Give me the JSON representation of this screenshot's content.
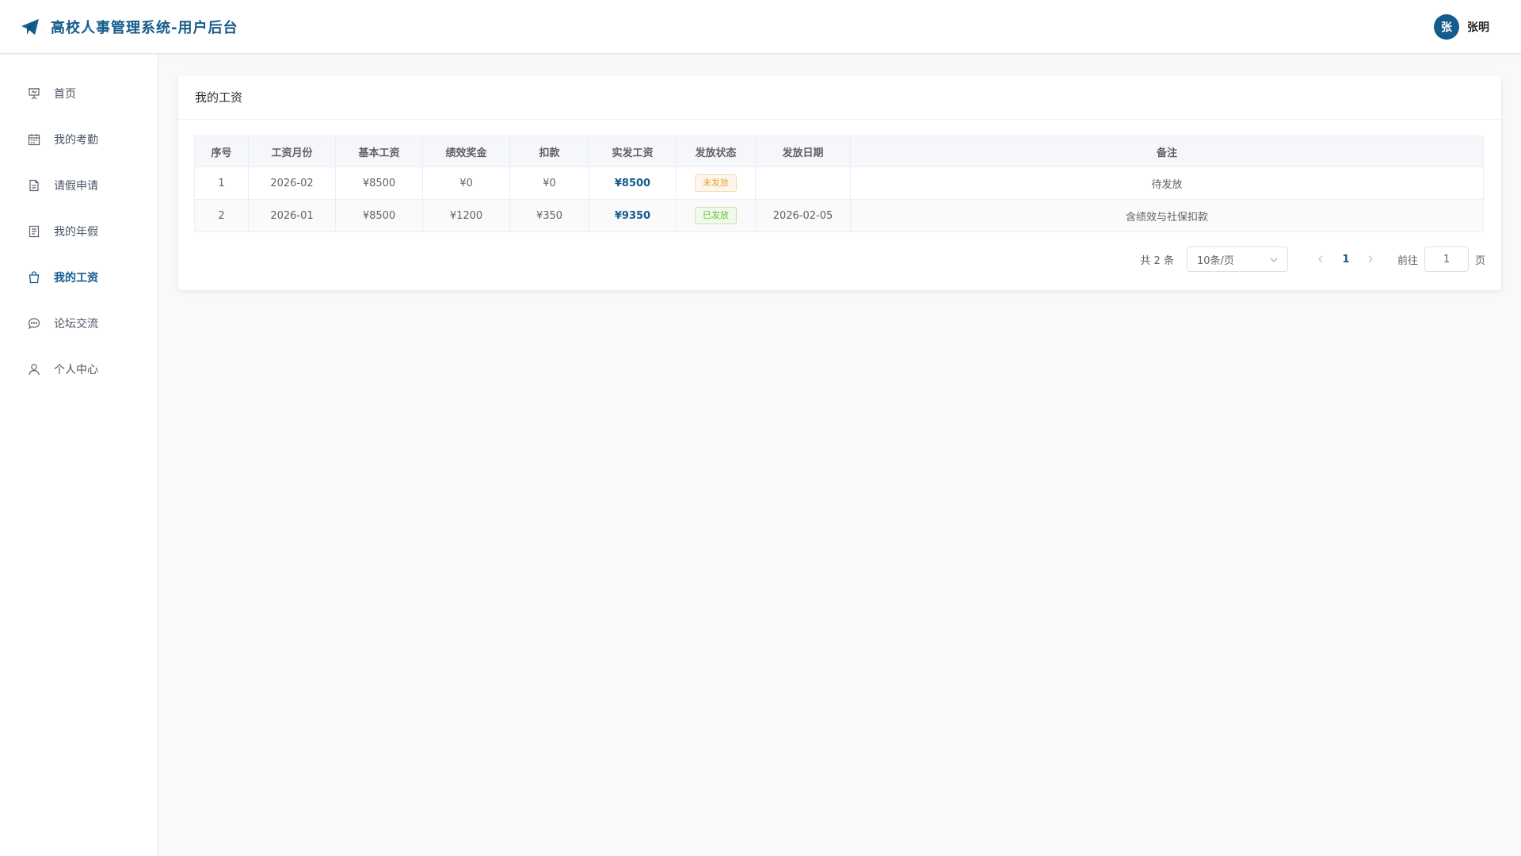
{
  "header": {
    "title": "高校人事管理系统-用户后台",
    "user_avatar_text": "张",
    "user_name": "张明",
    "accent_color": "#145c8c"
  },
  "sidebar": {
    "items": [
      {
        "label": "首页",
        "icon": "presentation-icon"
      },
      {
        "label": "我的考勤",
        "icon": "calendar-icon"
      },
      {
        "label": "请假申请",
        "icon": "document-icon"
      },
      {
        "label": "我的年假",
        "icon": "list-document-icon"
      },
      {
        "label": "我的工资",
        "icon": "shopping-bag-icon",
        "active": true
      },
      {
        "label": "论坛交流",
        "icon": "chat-bubble-icon"
      },
      {
        "label": "个人中心",
        "icon": "user-icon"
      }
    ]
  },
  "main": {
    "card_title": "我的工资",
    "table": {
      "columns": [
        "序号",
        "工资月份",
        "基本工资",
        "绩效奖金",
        "扣款",
        "实发工资",
        "发放状态",
        "发放日期",
        "备注"
      ],
      "rows": [
        {
          "index": "1",
          "month": "2026-02",
          "base": "¥8500",
          "bonus": "¥0",
          "deduction": "¥0",
          "net": "¥8500",
          "status": "未发放",
          "status_type": "pending",
          "date": "",
          "remark": "待发放"
        },
        {
          "index": "2",
          "month": "2026-01",
          "base": "¥8500",
          "bonus": "¥1200",
          "deduction": "¥350",
          "net": "¥9350",
          "status": "已发放",
          "status_type": "paid",
          "date": "2026-02-05",
          "remark": "含绩效与社保扣款"
        }
      ]
    },
    "pagination": {
      "total_text": "共 2 条",
      "page_size": "10条/页",
      "current_page": "1",
      "goto_label": "前往",
      "goto_value": "1",
      "page_suffix": "页"
    }
  }
}
